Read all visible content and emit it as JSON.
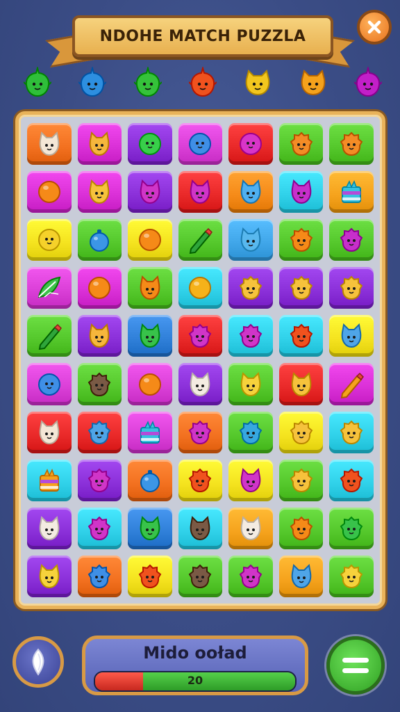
{
  "header": {
    "title": "NDOHE MATCH PUZZLA",
    "close_icon": "close-icon"
  },
  "goal_creatures": [
    {
      "kind": "creature-icon",
      "color": "#2fbf3a"
    },
    {
      "kind": "creature-icon",
      "color": "#2d8fe0"
    },
    {
      "kind": "creature-icon",
      "color": "#35c23a"
    },
    {
      "kind": "creature-icon",
      "color": "#f0521e"
    },
    {
      "kind": "cat-icon",
      "color": "#f2c61e"
    },
    {
      "kind": "cat-icon",
      "color": "#f5a21c"
    },
    {
      "kind": "creature-icon",
      "color": "#c31fc8"
    }
  ],
  "board": {
    "rows": [
      [
        {
          "bg": "#f2701f",
          "icon": "cat",
          "ic": "#f4e7d6"
        },
        {
          "bg": "#d92fd6",
          "icon": "cat",
          "ic": "#f6b63c"
        },
        {
          "bg": "#8a2fd8",
          "icon": "ball",
          "ic": "#38cf4a"
        },
        {
          "bg": "#d93ed6",
          "icon": "ball",
          "ic": "#3f8fe6"
        },
        {
          "bg": "#e82828",
          "icon": "ball",
          "ic": "#d835c8"
        },
        {
          "bg": "#54c72b",
          "icon": "blob",
          "ic": "#f38c26"
        },
        {
          "bg": "#54c72b",
          "icon": "blob",
          "ic": "#f38c26"
        }
      ],
      [
        {
          "bg": "#d92fd6",
          "icon": "orb",
          "ic": "#f58a18"
        },
        {
          "bg": "#d92fd6",
          "icon": "cat",
          "ic": "#f6c23c"
        },
        {
          "bg": "#8a2fd8",
          "icon": "cat",
          "ic": "#d035c8"
        },
        {
          "bg": "#e82828",
          "icon": "cat",
          "ic": "#d035c8"
        },
        {
          "bg": "#f58a18",
          "icon": "cat",
          "ic": "#4fb0f0"
        },
        {
          "bg": "#2fd0e8",
          "icon": "cat",
          "ic": "#c72fcb"
        },
        {
          "bg": "#f5a21c",
          "icon": "cake",
          "ic": "#37c2e0"
        }
      ],
      [
        {
          "bg": "#f4e21e",
          "icon": "ball",
          "ic": "#f5d12a"
        },
        {
          "bg": "#54c72b",
          "icon": "bomb",
          "ic": "#3c96e6"
        },
        {
          "bg": "#f4e21e",
          "icon": "orb",
          "ic": "#f58a18"
        },
        {
          "bg": "#54c72b",
          "icon": "pencil",
          "ic": "#2fa53b"
        },
        {
          "bg": "#3fa5e8",
          "icon": "cat",
          "ic": "#58b8ee"
        },
        {
          "bg": "#54c72b",
          "icon": "blob",
          "ic": "#f58a18"
        },
        {
          "bg": "#54c72b",
          "icon": "blob",
          "ic": "#c72fcb"
        }
      ],
      [
        {
          "bg": "#d93ed6",
          "icon": "leaf",
          "ic": "#3ec24a"
        },
        {
          "bg": "#d92fd6",
          "icon": "orb",
          "ic": "#f58a18"
        },
        {
          "bg": "#54c72b",
          "icon": "cat",
          "ic": "#f58a18"
        },
        {
          "bg": "#2fd0e8",
          "icon": "orb",
          "ic": "#f5b21a"
        },
        {
          "bg": "#8a2fd8",
          "icon": "blob",
          "ic": "#f6c23c"
        },
        {
          "bg": "#8a2fd8",
          "icon": "blob",
          "ic": "#f6c23c"
        },
        {
          "bg": "#8a2fd8",
          "icon": "blob",
          "ic": "#f6c23c"
        }
      ],
      [
        {
          "bg": "#54c72b",
          "icon": "pencil",
          "ic": "#2fa53b"
        },
        {
          "bg": "#8a2fd8",
          "icon": "cat",
          "ic": "#f6b63c"
        },
        {
          "bg": "#2f7fd8",
          "icon": "cat",
          "ic": "#38c24a"
        },
        {
          "bg": "#e82828",
          "icon": "blob",
          "ic": "#d035c8"
        },
        {
          "bg": "#2fd0e8",
          "icon": "blob",
          "ic": "#d035c8"
        },
        {
          "bg": "#2fd0e8",
          "icon": "blob",
          "ic": "#f0521e"
        },
        {
          "bg": "#f4e21e",
          "icon": "cat",
          "ic": "#4fa5e8"
        }
      ],
      [
        {
          "bg": "#d93ed6",
          "icon": "ball",
          "ic": "#3f8fe6"
        },
        {
          "bg": "#54c72b",
          "icon": "blob",
          "ic": "#7a5a45"
        },
        {
          "bg": "#d93ed6",
          "icon": "orb",
          "ic": "#f58a18"
        },
        {
          "bg": "#8a2fd8",
          "icon": "cat",
          "ic": "#f4ece2"
        },
        {
          "bg": "#54c72b",
          "icon": "cat",
          "ic": "#f6d23c"
        },
        {
          "bg": "#e82828",
          "icon": "cat",
          "ic": "#f6c23c"
        },
        {
          "bg": "#d92fd6",
          "icon": "pencil",
          "ic": "#f5a21c"
        }
      ],
      [
        {
          "bg": "#e82828",
          "icon": "cat",
          "ic": "#f4e7d6"
        },
        {
          "bg": "#e82828",
          "icon": "blob",
          "ic": "#4fa5e8"
        },
        {
          "bg": "#d93ed6",
          "icon": "cake",
          "ic": "#37c2e0"
        },
        {
          "bg": "#f2701f",
          "icon": "blob",
          "ic": "#d035c8"
        },
        {
          "bg": "#54c72b",
          "icon": "blob",
          "ic": "#37a8e0"
        },
        {
          "bg": "#f4e21e",
          "icon": "blob",
          "ic": "#f6c23c"
        },
        {
          "bg": "#2fd0e8",
          "icon": "blob",
          "ic": "#f6c23c"
        }
      ],
      [
        {
          "bg": "#2fd0e8",
          "icon": "cake",
          "ic": "#f5a21c"
        },
        {
          "bg": "#8a2fd8",
          "icon": "blob",
          "ic": "#d035c8"
        },
        {
          "bg": "#f2701f",
          "icon": "bomb",
          "ic": "#3c96e6"
        },
        {
          "bg": "#f4e21e",
          "icon": "blob",
          "ic": "#f0521e"
        },
        {
          "bg": "#f4e21e",
          "icon": "cat",
          "ic": "#d035c8"
        },
        {
          "bg": "#54c72b",
          "icon": "blob",
          "ic": "#f6c23c"
        },
        {
          "bg": "#2fd0e8",
          "icon": "blob",
          "ic": "#f0521e"
        }
      ],
      [
        {
          "bg": "#8a2fd8",
          "icon": "cat",
          "ic": "#f4ece2"
        },
        {
          "bg": "#2fd0e8",
          "icon": "blob",
          "ic": "#d035c8"
        },
        {
          "bg": "#2f7fd8",
          "icon": "cat",
          "ic": "#38c24a"
        },
        {
          "bg": "#2fd0e8",
          "icon": "cat",
          "ic": "#7a5a45"
        },
        {
          "bg": "#f5a21c",
          "icon": "cat",
          "ic": "#f4ece2"
        },
        {
          "bg": "#54c72b",
          "icon": "blob",
          "ic": "#f58a18"
        },
        {
          "bg": "#54c72b",
          "icon": "blob",
          "ic": "#38c24a"
        }
      ],
      [
        {
          "bg": "#8a2fd8",
          "icon": "cat",
          "ic": "#f6d23c"
        },
        {
          "bg": "#f2701f",
          "icon": "blob",
          "ic": "#3f8fe6"
        },
        {
          "bg": "#f4e21e",
          "icon": "blob",
          "ic": "#f0521e"
        },
        {
          "bg": "#54c72b",
          "icon": "blob",
          "ic": "#7a5a45"
        },
        {
          "bg": "#54c72b",
          "icon": "blob",
          "ic": "#d035c8"
        },
        {
          "bg": "#f5a21c",
          "icon": "cat",
          "ic": "#4fa5e8"
        },
        {
          "bg": "#54c72b",
          "icon": "blob",
          "ic": "#f6d23c"
        }
      ]
    ]
  },
  "footer": {
    "left_button_icon": "gem-icon",
    "status_title": "Mido ooład",
    "progress_value": "20",
    "progress_fraction": 0.24,
    "progress_warning_fraction": 0.24,
    "menu_icon": "menu-icon"
  }
}
